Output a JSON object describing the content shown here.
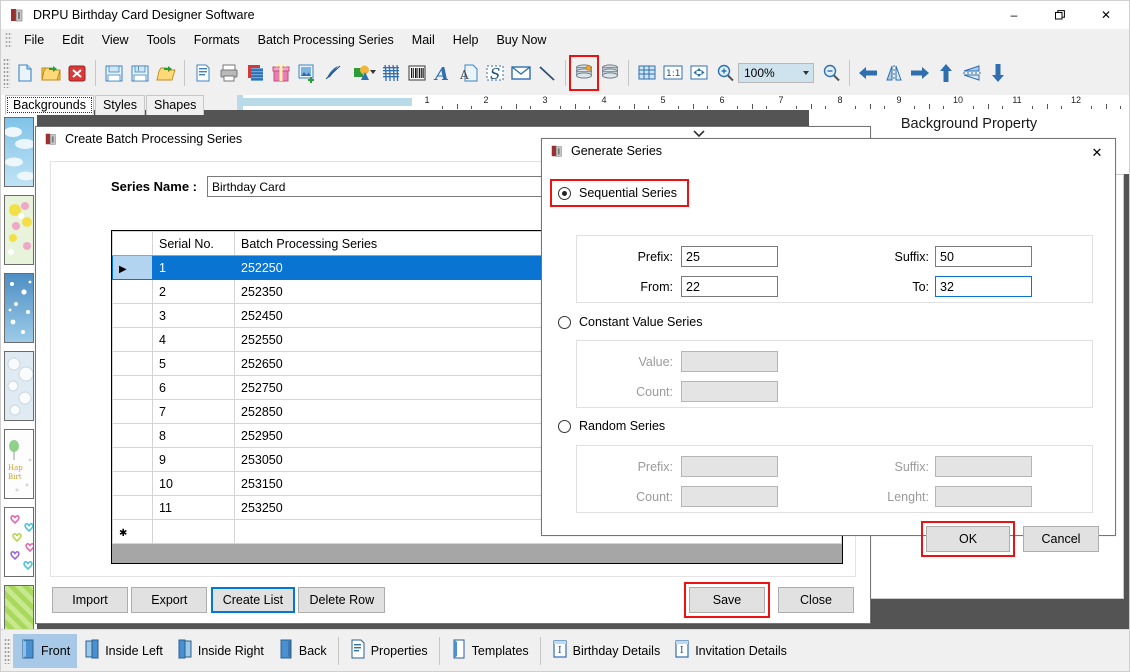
{
  "window": {
    "title": "DRPU Birthday Card Designer Software",
    "minimize": "–",
    "maximize": "❐",
    "close": "✕"
  },
  "menu": {
    "items": [
      {
        "label": "File"
      },
      {
        "label": "Edit"
      },
      {
        "label": "View"
      },
      {
        "label": "Tools"
      },
      {
        "label": "Formats"
      },
      {
        "label": "Batch Processing Series"
      },
      {
        "label": "Mail"
      },
      {
        "label": "Help"
      },
      {
        "label": "Buy Now"
      }
    ]
  },
  "toolbar": {
    "zoom_value": "100%",
    "icons": [
      "new-document-icon",
      "open-folder-icon",
      "close-document-icon",
      "save-icon",
      "save-as-icon",
      "import-folder-icon",
      "page-setup-icon",
      "print-icon",
      "card-layers-icon",
      "gift-icon",
      "insert-image-icon",
      "pen-tool-icon",
      "shapes-icon",
      "signature-icon",
      "barcode-icon",
      "text-tool-icon",
      "watermark-icon",
      "symbol-icon",
      "envelope-icon",
      "line-tool-icon",
      "batch-series-icon",
      "database-icon",
      "grid-icon",
      "actual-size-icon",
      "fit-to-screen-icon",
      "zoom-in-icon",
      "zoom-out-icon",
      "arrow-left-icon",
      "flip-horizontal-icon",
      "arrow-right-icon",
      "arrow-up-icon",
      "flip-vertical-icon",
      "arrow-down-icon"
    ]
  },
  "left_panel": {
    "tabs": [
      {
        "label": "Backgrounds",
        "active": true
      },
      {
        "label": "Styles",
        "active": false
      },
      {
        "label": "Shapes",
        "active": false
      }
    ],
    "thumbnails": [
      "clouds-background",
      "flowers-background",
      "stars-background",
      "bubbles-background",
      "happy-birthday-background",
      "hearts-background",
      "green-stripes-background"
    ]
  },
  "canvas": {
    "background_property_title": "Background Property",
    "ruler_numbers": [
      "1",
      "2",
      "3",
      "4",
      "5",
      "6",
      "7",
      "8",
      "9",
      "10",
      "11",
      "12"
    ]
  },
  "batch_dialog": {
    "title": "Create Batch Processing Series",
    "icon": "app-icon",
    "series_name_label": "Series Name :",
    "series_name_value": "Birthday Card",
    "columns": [
      "",
      "Serial No.",
      "Batch Processing Series"
    ],
    "rows": [
      {
        "mark": "▶",
        "serial": "1",
        "series": "252250",
        "selected": true
      },
      {
        "mark": "",
        "serial": "2",
        "series": "252350",
        "selected": false
      },
      {
        "mark": "",
        "serial": "3",
        "series": "252450",
        "selected": false
      },
      {
        "mark": "",
        "serial": "4",
        "series": "252550",
        "selected": false
      },
      {
        "mark": "",
        "serial": "5",
        "series": "252650",
        "selected": false
      },
      {
        "mark": "",
        "serial": "6",
        "series": "252750",
        "selected": false
      },
      {
        "mark": "",
        "serial": "7",
        "series": "252850",
        "selected": false
      },
      {
        "mark": "",
        "serial": "8",
        "series": "252950",
        "selected": false
      },
      {
        "mark": "",
        "serial": "9",
        "series": "253050",
        "selected": false
      },
      {
        "mark": "",
        "serial": "10",
        "series": "253150",
        "selected": false
      },
      {
        "mark": "",
        "serial": "11",
        "series": "253250",
        "selected": false
      },
      {
        "mark": "✱",
        "serial": "",
        "series": "",
        "selected": false
      }
    ],
    "buttons": {
      "import": "Import",
      "export": "Export",
      "create_list": "Create List",
      "delete_row": "Delete Row",
      "save": "Save",
      "close": "Close"
    }
  },
  "generate_dialog": {
    "title": "Generate Series",
    "icon": "app-icon",
    "close_glyph": "✕",
    "sequential": {
      "label": "Sequential Series",
      "selected": true,
      "prefix_label": "Prefix:",
      "prefix_value": "25",
      "suffix_label": "Suffix:",
      "suffix_value": "50",
      "from_label": "From:",
      "from_value": "22",
      "to_label": "To:",
      "to_value": "32"
    },
    "constant": {
      "label": "Constant Value Series",
      "selected": false,
      "value_label": "Value:",
      "value_value": "",
      "count_label": "Count:",
      "count_value": ""
    },
    "random": {
      "label": "Random Series",
      "selected": false,
      "prefix_label": "Prefix:",
      "prefix_value": "",
      "suffix_label": "Suffix:",
      "suffix_value": "",
      "count_label": "Count:",
      "count_value": "",
      "length_label": "Lenght:",
      "length_value": ""
    },
    "ok_label": "OK",
    "cancel_label": "Cancel"
  },
  "statusbar": {
    "items": [
      {
        "label": "Front",
        "icon": "card-front-icon",
        "active": true
      },
      {
        "label": "Inside Left",
        "icon": "card-inside-left-icon",
        "active": false
      },
      {
        "label": "Inside Right",
        "icon": "card-inside-right-icon",
        "active": false
      },
      {
        "label": "Back",
        "icon": "card-back-icon",
        "active": false
      },
      {
        "label": "Properties",
        "icon": "properties-icon",
        "active": false
      },
      {
        "label": "Templates",
        "icon": "templates-icon",
        "active": false
      },
      {
        "label": "Birthday Details",
        "icon": "birthday-details-icon",
        "active": false
      },
      {
        "label": "Invitation Details",
        "icon": "invitation-details-icon",
        "active": false
      }
    ]
  },
  "colors": {
    "accent": "#0a74d2",
    "highlight_red": "#ee1111",
    "canvas": "#545454",
    "chrome": "#f0f0f0"
  }
}
